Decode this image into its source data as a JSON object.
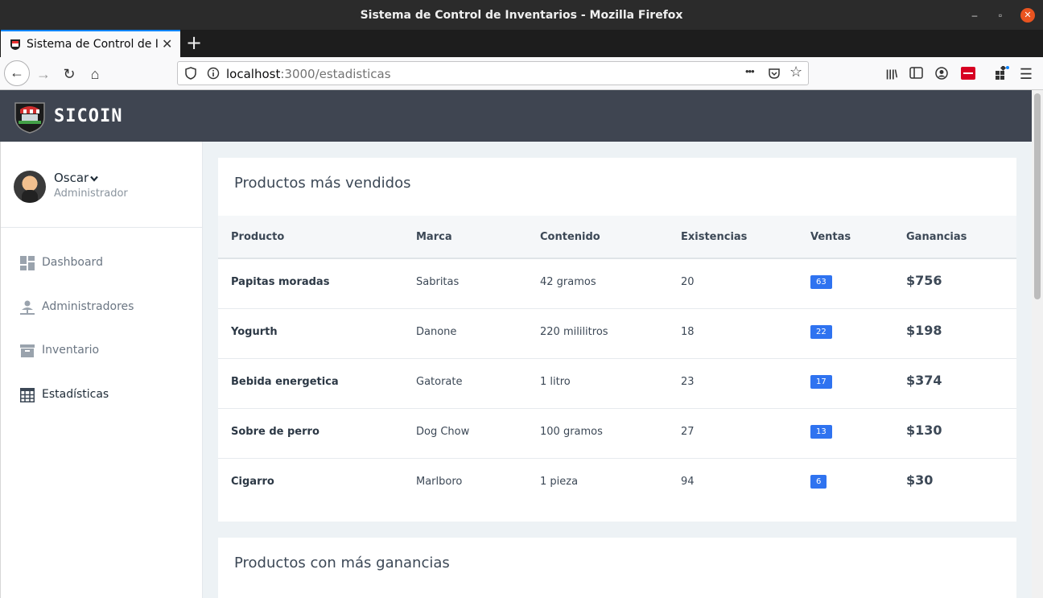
{
  "window": {
    "title": "Sistema de Control de Inventarios - Mozilla Firefox",
    "minimize_glyph": "–",
    "maximize_glyph": "▫",
    "close_glyph": "✕"
  },
  "tab": {
    "label": "Sistema de Control de Inventarios",
    "close_glyph": "✕",
    "newtab_glyph": "+"
  },
  "navbar": {
    "url_host": "localhost",
    "url_path": ":3000/estadisticas",
    "back_glyph": "←",
    "forward_glyph": "→",
    "reload_glyph": "↻",
    "home_glyph": "⌂",
    "more_glyph": "•••",
    "star_glyph": "☆",
    "library_glyph": "|||\\",
    "menu_glyph": "☰"
  },
  "app": {
    "brand": "SICOIN"
  },
  "user": {
    "name": "Oscar",
    "role": "Administrador"
  },
  "sidebar": {
    "items": [
      {
        "label": "Dashboard",
        "icon": "dashboard-icon"
      },
      {
        "label": "Administradores",
        "icon": "user-icon"
      },
      {
        "label": "Inventario",
        "icon": "archive-icon"
      },
      {
        "label": "Estadísticas",
        "icon": "table-icon"
      }
    ]
  },
  "best_sellers": {
    "title": "Productos más vendidos",
    "columns": [
      "Producto",
      "Marca",
      "Contenido",
      "Existencias",
      "Ventas",
      "Ganancias"
    ],
    "rows": [
      {
        "product": "Papitas moradas",
        "brand": "Sabritas",
        "content": "42 gramos",
        "stock": "20",
        "sales": "63",
        "profit": "$756"
      },
      {
        "product": "Yogurth",
        "brand": "Danone",
        "content": "220 mililitros",
        "stock": "18",
        "sales": "22",
        "profit": "$198"
      },
      {
        "product": "Bebida energetica",
        "brand": "Gatorate",
        "content": "1 litro",
        "stock": "23",
        "sales": "17",
        "profit": "$374"
      },
      {
        "product": "Sobre de perro",
        "brand": "Dog Chow",
        "content": "100 gramos",
        "stock": "27",
        "sales": "13",
        "profit": "$130"
      },
      {
        "product": "Cigarro",
        "brand": "Marlboro",
        "content": "1 pieza",
        "stock": "94",
        "sales": "6",
        "profit": "$30"
      }
    ]
  },
  "top_profit": {
    "title": "Productos con más ganancias"
  },
  "colors": {
    "header_bg": "#3f4551",
    "badge": "#2f73f0",
    "main_bg": "#edf2f5",
    "close_button": "#e95420"
  }
}
